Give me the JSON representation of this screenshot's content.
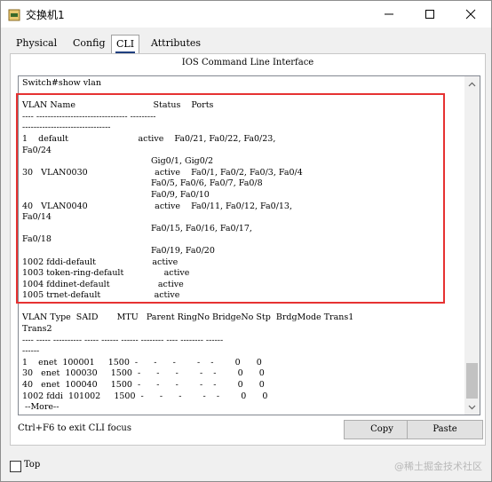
{
  "window": {
    "title": "交换机1"
  },
  "tabs": [
    {
      "label": "Physical"
    },
    {
      "label": "Config"
    },
    {
      "label": "CLI"
    },
    {
      "label": "Attributes"
    }
  ],
  "cli_panel": {
    "title": "IOS Command Line Interface",
    "output": "Switch#show vlan\n\nVLAN Name                             Status    Ports\n---- -------------------------------- ---------\n-------------------------------\n1    default                          active    Fa0/21, Fa0/22, Fa0/23,\nFa0/24\n                                                Gig0/1, Gig0/2\n30   VLAN0030                         active    Fa0/1, Fa0/2, Fa0/3, Fa0/4\n                                                Fa0/5, Fa0/6, Fa0/7, Fa0/8\n                                                Fa0/9, Fa0/10\n40   VLAN0040                         active    Fa0/11, Fa0/12, Fa0/13,\nFa0/14\n                                                Fa0/15, Fa0/16, Fa0/17,\nFa0/18\n                                                Fa0/19, Fa0/20\n1002 fddi-default                     active\n1003 token-ring-default               active\n1004 fddinet-default                  active\n1005 trnet-default                    active\n\nVLAN Type  SAID       MTU   Parent RingNo BridgeNo Stp  BrdgMode Trans1\nTrans2\n---- ----- ---------- ----- ------ ------ -------- ---- -------- ------\n------\n1    enet  100001     1500  -      -      -        -    -        0      0\n30   enet  100030     1500  -      -      -        -    -        0      0\n40   enet  100040     1500  -      -      -        -    -        0      0\n1002 fddi  101002     1500  -      -      -        -    -        0      0\n --More--",
    "focus_hint": "Ctrl+F6 to exit CLI focus",
    "copy_label": "Copy",
    "paste_label": "Paste"
  },
  "bottom": {
    "top_label": "Top",
    "top_checked": false,
    "watermark": "@稀土掘金技术社区"
  },
  "colors": {
    "highlight": "#e63232",
    "active_tab_underline": "#1f3f7f"
  }
}
